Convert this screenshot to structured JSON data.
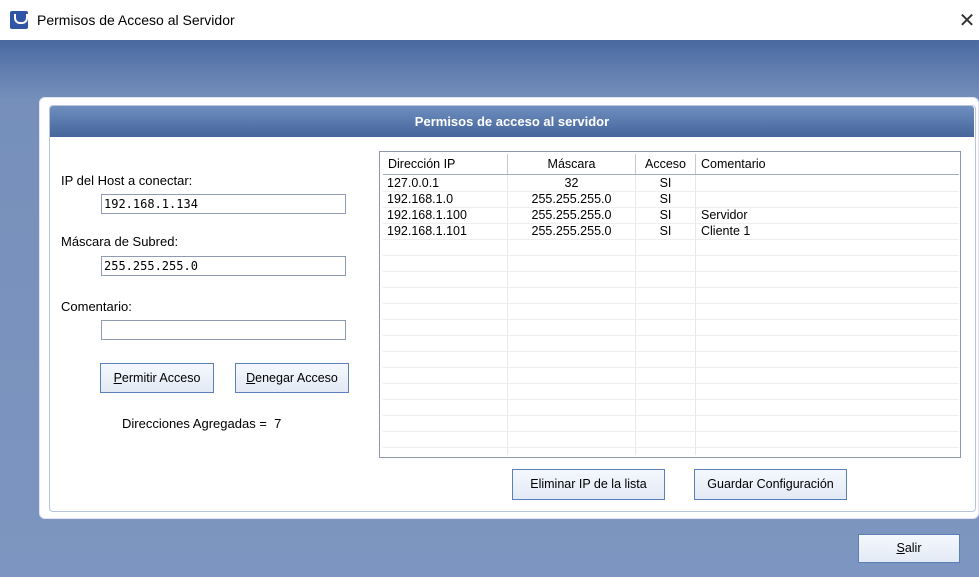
{
  "window": {
    "title": "Permisos de Acceso al Servidor",
    "close_glyph": "✕"
  },
  "panel": {
    "title": "Permisos de acceso al servidor"
  },
  "form": {
    "host_label": "IP del Host a conectar:",
    "host_value": "192.168.1.134",
    "mask_label": "Máscara de Subred:",
    "mask_value": "255.255.255.0",
    "comment_label": "Comentario:",
    "comment_value": "",
    "allow_button": {
      "ul": "P",
      "rest": "ermitir Acceso"
    },
    "deny_button": {
      "ul": "D",
      "rest": "enegar Acceso"
    },
    "count_text": "Direcciones Agregadas =  7"
  },
  "table": {
    "columns": [
      "Dirección IP",
      "Máscara",
      "Acceso",
      "Comentario"
    ],
    "rows": [
      [
        "127.0.0.1",
        "32",
        "SI",
        ""
      ],
      [
        "192.168.1.0",
        "255.255.255.0",
        "SI",
        ""
      ],
      [
        "192.168.1.100",
        "255.255.255.0",
        "SI",
        "Servidor"
      ],
      [
        "192.168.1.101",
        "255.255.255.0",
        "SI",
        "Cliente 1"
      ]
    ]
  },
  "actions": {
    "remove_label": "Eliminar IP de la lista",
    "save_label": "Guardar Configuración",
    "exit_button": {
      "ul": "S",
      "rest": "alir"
    }
  },
  "colors": {
    "header_top": "#6f8ebf",
    "header_bottom": "#45659c",
    "background": "#7d96c1",
    "button_border": "#5d7fb8"
  }
}
